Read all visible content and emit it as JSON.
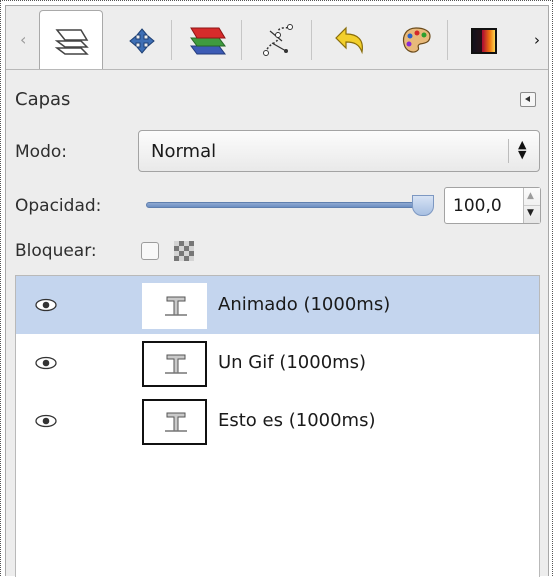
{
  "panel": {
    "tabs": [
      {
        "icon": "layers-icon",
        "active": true
      },
      {
        "icon": "move-icon"
      },
      {
        "icon": "channels-icon"
      },
      {
        "icon": "paths-icon"
      },
      {
        "icon": "undo-history-icon"
      },
      {
        "icon": "palette-icon"
      },
      {
        "icon": "gradient-icon"
      }
    ],
    "title": "Capas"
  },
  "mode": {
    "label": "Modo:",
    "value": "Normal"
  },
  "opacity": {
    "label": "Opacidad:",
    "value": "100,0",
    "level": 1.0
  },
  "lock": {
    "label": "Bloquear:"
  },
  "layers": [
    {
      "name": "Animado (1000ms)",
      "selected": true,
      "visible": true
    },
    {
      "name": "Un Gif (1000ms)",
      "selected": false,
      "visible": true
    },
    {
      "name": "Esto es (1000ms)",
      "selected": false,
      "visible": true
    }
  ],
  "colors": {
    "selection": "#c4d5ee",
    "slider": "#7b9bcb"
  }
}
